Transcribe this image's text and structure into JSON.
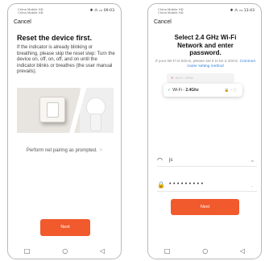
{
  "left_phone": {
    "status_carrier": "China Mobile HD\nChina Mobile HD",
    "status_right": "✱ ⁂ ▭ 09:03",
    "cancel": "Cancel",
    "title": "Reset the device first.",
    "body": "If the indicator is already blinking or breathing, please skip the reset step: Turn the device on, off, on, off, and on until the indicator blinks or breathes (the user manual prevails).",
    "caption": "Perform net pairing as prompted.",
    "caption_chevron": ">",
    "next_button": "Next"
  },
  "right_phone": {
    "status_carrier": "China Mobile HD\nChina Mobile HD",
    "status_right": "✱ ⁂ ▭ 13:43",
    "cancel": "Cancel",
    "title": "Select 2.4 GHz Wi-Fi Network and enter password.",
    "hint": "If your Wi-Fi is 5GHz, please set it to be 2.4GHz.",
    "hint_link": "Common router setting method",
    "wifi_5g_label": "Wi-Fi - 5Ghz",
    "wifi_24_prefix": "Wi-Fi - ",
    "wifi_24_band": "2.4Ghz",
    "ssid_value": "js",
    "ssid_side": "⇆",
    "password_mask": "•••••••••",
    "password_side": "⌄",
    "next_button": "Next"
  },
  "nav": {
    "square": "□",
    "circle": "○",
    "back": "◁"
  },
  "colors": {
    "accent": "#f05a2c",
    "link": "#2f7fd8",
    "check": "#2ea44f",
    "error": "#e35050"
  }
}
